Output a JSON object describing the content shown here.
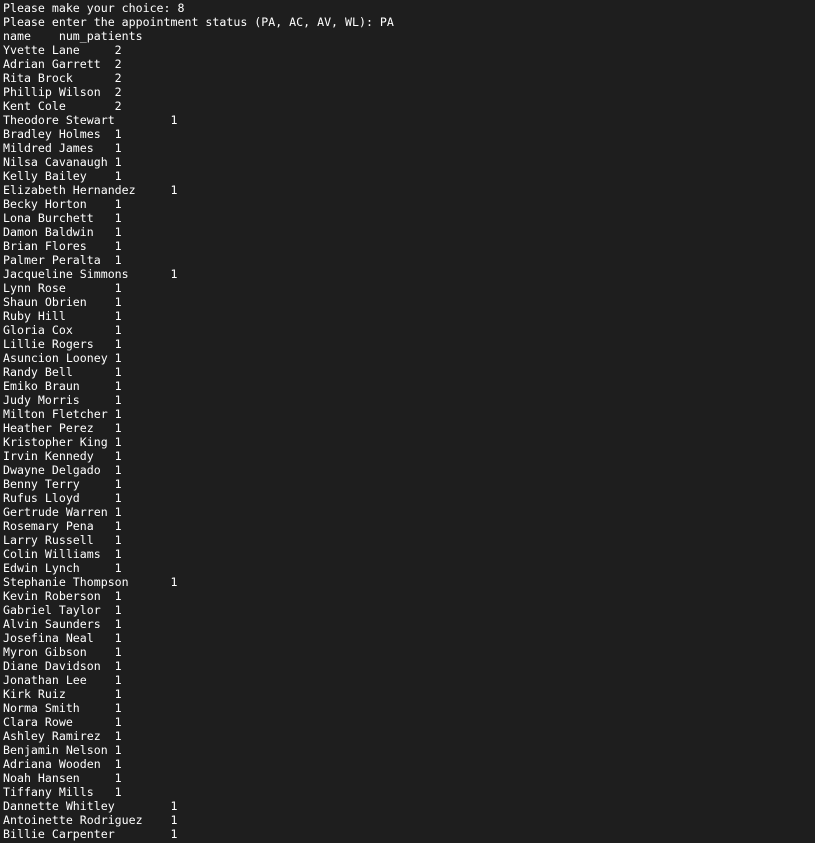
{
  "terminal": {
    "lines": [
      "Please make your choice: 8",
      "Please enter the appointment status (PA, AC, AV, WL): PA",
      "name\tnum_patients",
      "Yvette Lane\t2",
      "Adrian Garrett\t2",
      "Rita Brock\t2",
      "Phillip Wilson\t2",
      "Kent Cole\t2",
      "Theodore Stewart\t1",
      "Bradley Holmes\t1",
      "Mildred James\t1",
      "Nilsa Cavanaugh\t1",
      "Kelly Bailey\t1",
      "Elizabeth Hernandez\t1",
      "Becky Horton\t1",
      "Lona Burchett\t1",
      "Damon Baldwin\t1",
      "Brian Flores\t1",
      "Palmer Peralta\t1",
      "Jacqueline Simmons\t1",
      "Lynn Rose\t1",
      "Shaun Obrien\t1",
      "Ruby Hill\t1",
      "Gloria Cox\t1",
      "Lillie Rogers\t1",
      "Asuncion Looney\t1",
      "Randy Bell\t1",
      "Emiko Braun\t1",
      "Judy Morris\t1",
      "Milton Fletcher\t1",
      "Heather Perez\t1",
      "Kristopher King\t1",
      "Irvin Kennedy\t1",
      "Dwayne Delgado\t1",
      "Benny Terry\t1",
      "Rufus Lloyd\t1",
      "Gertrude Warren\t1",
      "Rosemary Pena\t1",
      "Larry Russell\t1",
      "Colin Williams\t1",
      "Edwin Lynch\t1",
      "Stephanie Thompson\t1",
      "Kevin Roberson\t1",
      "Gabriel Taylor\t1",
      "Alvin Saunders\t1",
      "Josefina Neal\t1",
      "Myron Gibson\t1",
      "Diane Davidson\t1",
      "Jonathan Lee\t1",
      "Kirk Ruiz\t1",
      "Norma Smith\t1",
      "Clara Rowe\t1",
      "Ashley Ramirez\t1",
      "Benjamin Nelson\t1",
      "Adriana Wooden\t1",
      "Noah Hansen\t1",
      "Tiffany Mills\t1",
      "Dannette Whitley\t1",
      "Antoinette Rodriguez\t1",
      "Billie Carpenter\t1"
    ]
  }
}
